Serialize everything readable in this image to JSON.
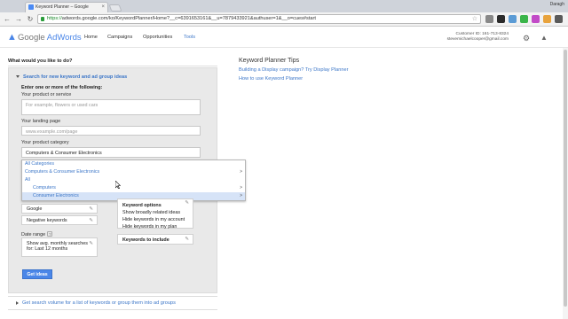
{
  "browser": {
    "tab_title": "Keyword Planner – Google",
    "tab_close": "×",
    "profile_name": "Daragh",
    "url_scheme": "https://",
    "url_rest": "adwords.google.com/ko/KeywordPlanner/Home?__c=6391653161&__u=7879433921&authuser=1&__o=cues#start",
    "back_icon": "←",
    "forward_icon": "→",
    "reload_icon": "↻",
    "star_icon": "☆",
    "extension_colors": [
      "#888888",
      "#2b2b2b",
      "#5b9bd5",
      "#3bb54a",
      "#c24bc7",
      "#e8a33d",
      "#5a5a5a"
    ]
  },
  "adwords": {
    "logo_brand": "Google",
    "logo_product": "AdWords",
    "nav": [
      "Home",
      "Campaigns",
      "Opportunities",
      "Tools"
    ],
    "active_nav": "Tools",
    "customer_id": "Customer ID: 161-713-8324",
    "customer_email": "stevemichaelcooper@gmail.com",
    "gear_icon": "⚙",
    "bell_icon": "🔔"
  },
  "form": {
    "question": "What would you like to do?",
    "section_link": "Search for new keyword and ad group ideas",
    "enter_label": "Enter one or more of the following:",
    "product_label": "Your product or service",
    "product_placeholder": "For example, flowers or used cars",
    "landing_label": "Your landing page",
    "landing_placeholder": "www.example.com/page",
    "category_label": "Your product category",
    "category_value": "Computers & Consumer Electronics",
    "dropdown": [
      {
        "label": "All Categories",
        "arrow": ""
      },
      {
        "label": "Computers & Consumer Electronics",
        "arrow": ">"
      },
      {
        "label": "All",
        "arrow": ""
      },
      {
        "label": "Computers",
        "arrow": ">"
      },
      {
        "label": "Consumer Electronics",
        "arrow": ">"
      }
    ],
    "google_label": "Google",
    "negative_label": "Negative keywords",
    "date_range_label": "Date range",
    "help_glyph": "?",
    "date_range_value": "Show avg. monthly searches for: Last 12 months",
    "keyword_options_title": "Keyword options",
    "keyword_options": [
      "Show broadly related ideas",
      "Hide keywords in my account",
      "Hide keywords in my plan"
    ],
    "keywords_to_include": "Keywords to include",
    "get_ideas": "Get ideas",
    "bottom_link": "Get search volume for a list of keywords or group them into ad groups",
    "pencil_icon": "✎"
  },
  "tips": {
    "title": "Keyword Planner Tips",
    "links": [
      "Building a Display campaign? Try Display Planner",
      "How to use Keyword Planner"
    ]
  },
  "colors": {
    "link": "#3d77c8",
    "button": "#4a86e8",
    "panel": "#e9e9e9"
  }
}
